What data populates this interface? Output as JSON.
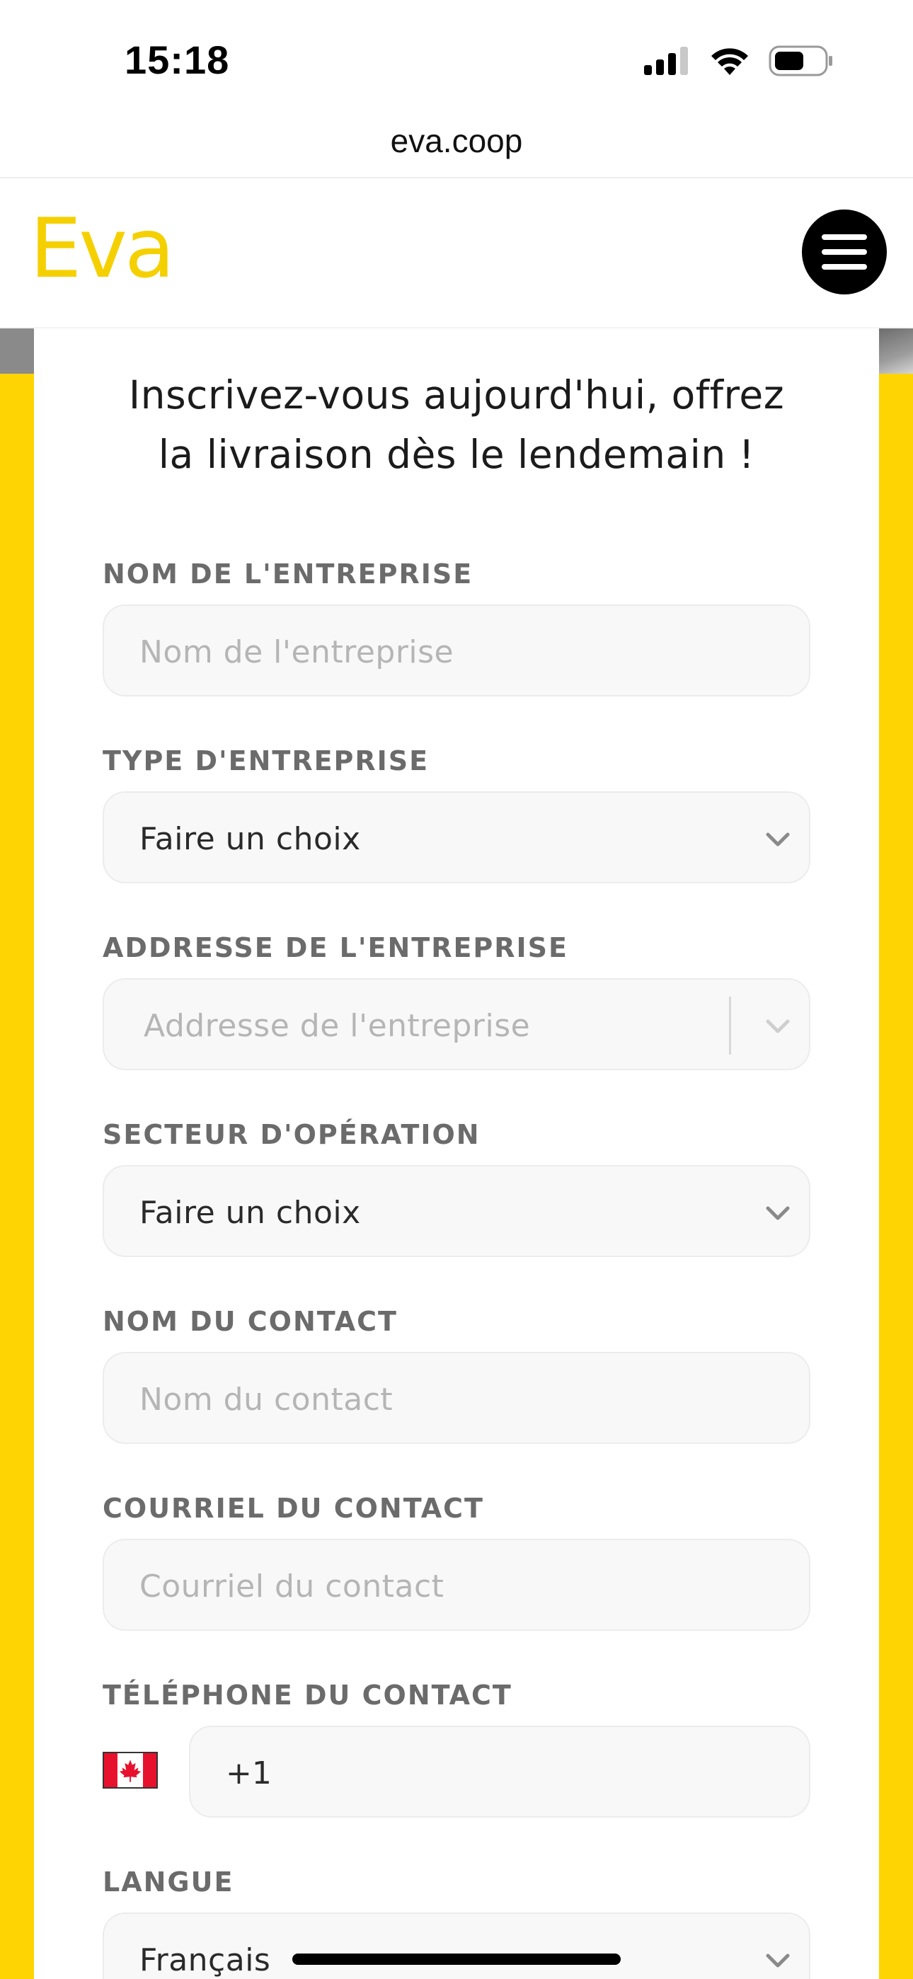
{
  "status_bar": {
    "time": "15:18",
    "icons": [
      "cellular-signal-icon",
      "wifi-icon",
      "battery-icon"
    ]
  },
  "browser": {
    "url": "eva.coop"
  },
  "header": {
    "logo": "Eva",
    "menu_icon": "hamburger-menu-icon"
  },
  "colors": {
    "brand_yellow": "#ffd403",
    "logo_yellow": "#f5d000",
    "field_bg": "#f8f8f8",
    "label_grey": "#6b6b6b"
  },
  "form": {
    "title_line1": "Inscrivez-vous aujourd'hui, offrez",
    "title_line2": "la livraison dès le lendemain !",
    "fields": {
      "company_name": {
        "label": "NOM DE L'ENTREPRISE",
        "placeholder": "Nom de l'entreprise",
        "value": ""
      },
      "company_type": {
        "label": "TYPE D'ENTREPRISE",
        "value": "Faire un choix"
      },
      "company_address": {
        "label": "ADDRESSE DE L'ENTREPRISE",
        "placeholder": "Addresse de l'entreprise",
        "value": ""
      },
      "sector": {
        "label": "SECTEUR D'OPÉRATION",
        "value": "Faire un choix"
      },
      "contact_name": {
        "label": "NOM DU CONTACT",
        "placeholder": "Nom du contact",
        "value": ""
      },
      "contact_email": {
        "label": "COURRIEL DU CONTACT",
        "placeholder": "Courriel du contact",
        "value": ""
      },
      "contact_phone": {
        "label": "TÉLÉPHONE DU CONTACT",
        "country_icon": "canada-flag-icon",
        "value": "+1"
      },
      "language": {
        "label": "LANGUE",
        "value": "Français"
      }
    }
  }
}
